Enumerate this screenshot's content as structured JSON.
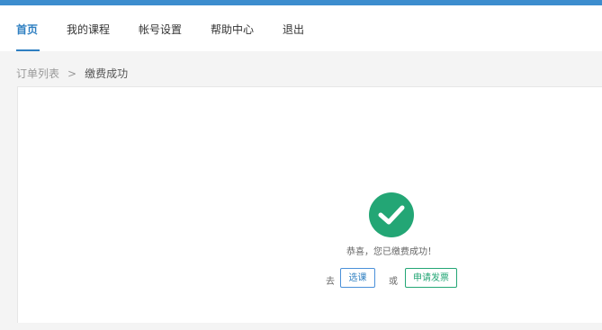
{
  "colors": {
    "top_bar": "#3c8dce",
    "nav_active": "#2e7fc1",
    "success": "#23a675",
    "course_button_border": "#4a90d9",
    "invoice_button_border": "#23a675",
    "page_background": "#f4f4f4"
  },
  "nav": {
    "items": [
      {
        "label": "首页",
        "active": true
      },
      {
        "label": "我的课程",
        "active": false
      },
      {
        "label": "帐号设置",
        "active": false
      },
      {
        "label": "帮助中心",
        "active": false
      },
      {
        "label": "退出",
        "active": false
      }
    ]
  },
  "breadcrumb": {
    "parent": "订单列表",
    "separator": ">",
    "current": "缴费成功"
  },
  "result": {
    "icon": "check-circle-icon",
    "message": "恭喜，您已缴费成功！",
    "go_text": "去",
    "course_button": "选课",
    "or_text": "或",
    "invoice_button": "申请发票"
  }
}
